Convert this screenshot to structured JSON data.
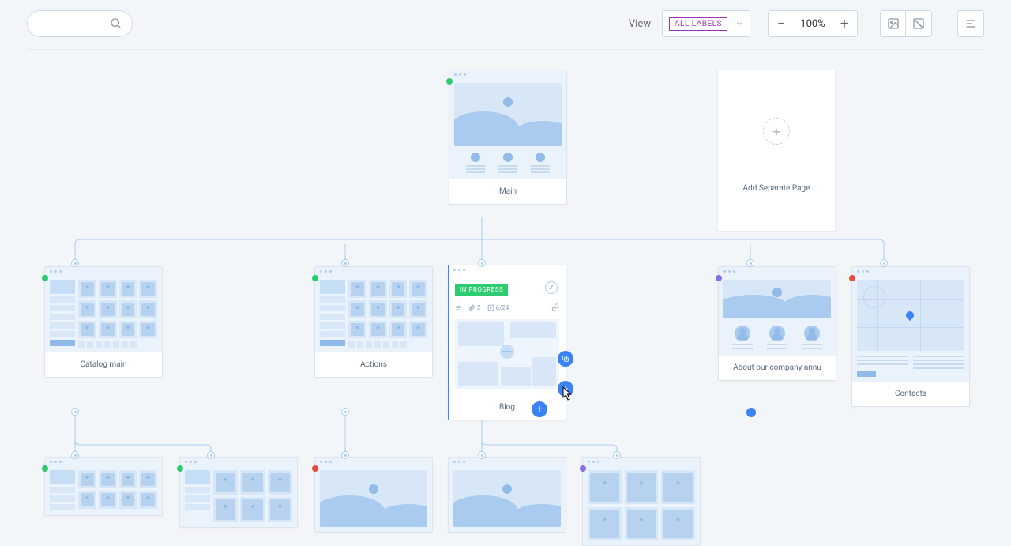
{
  "toolbar": {
    "view_label": "View",
    "labels_filter": "ALL LABELS",
    "zoom": "100%",
    "search_placeholder": ""
  },
  "add_page": {
    "label": "Add Separate Page"
  },
  "cards": {
    "main": {
      "label": "Main",
      "status": "green"
    },
    "catalog": {
      "label": "Catalog main",
      "status": "green"
    },
    "actions": {
      "label": "Actions",
      "status": "green"
    },
    "blog": {
      "label": "Blog",
      "badge": "IN PROGRESS",
      "attachments": "2",
      "tasks": "6/24"
    },
    "about": {
      "label": "About our company annu",
      "status": "purple"
    },
    "contacts": {
      "label": "Contacts",
      "status": "red"
    }
  },
  "child_statuses": [
    "green",
    "green",
    "red",
    "purple"
  ]
}
